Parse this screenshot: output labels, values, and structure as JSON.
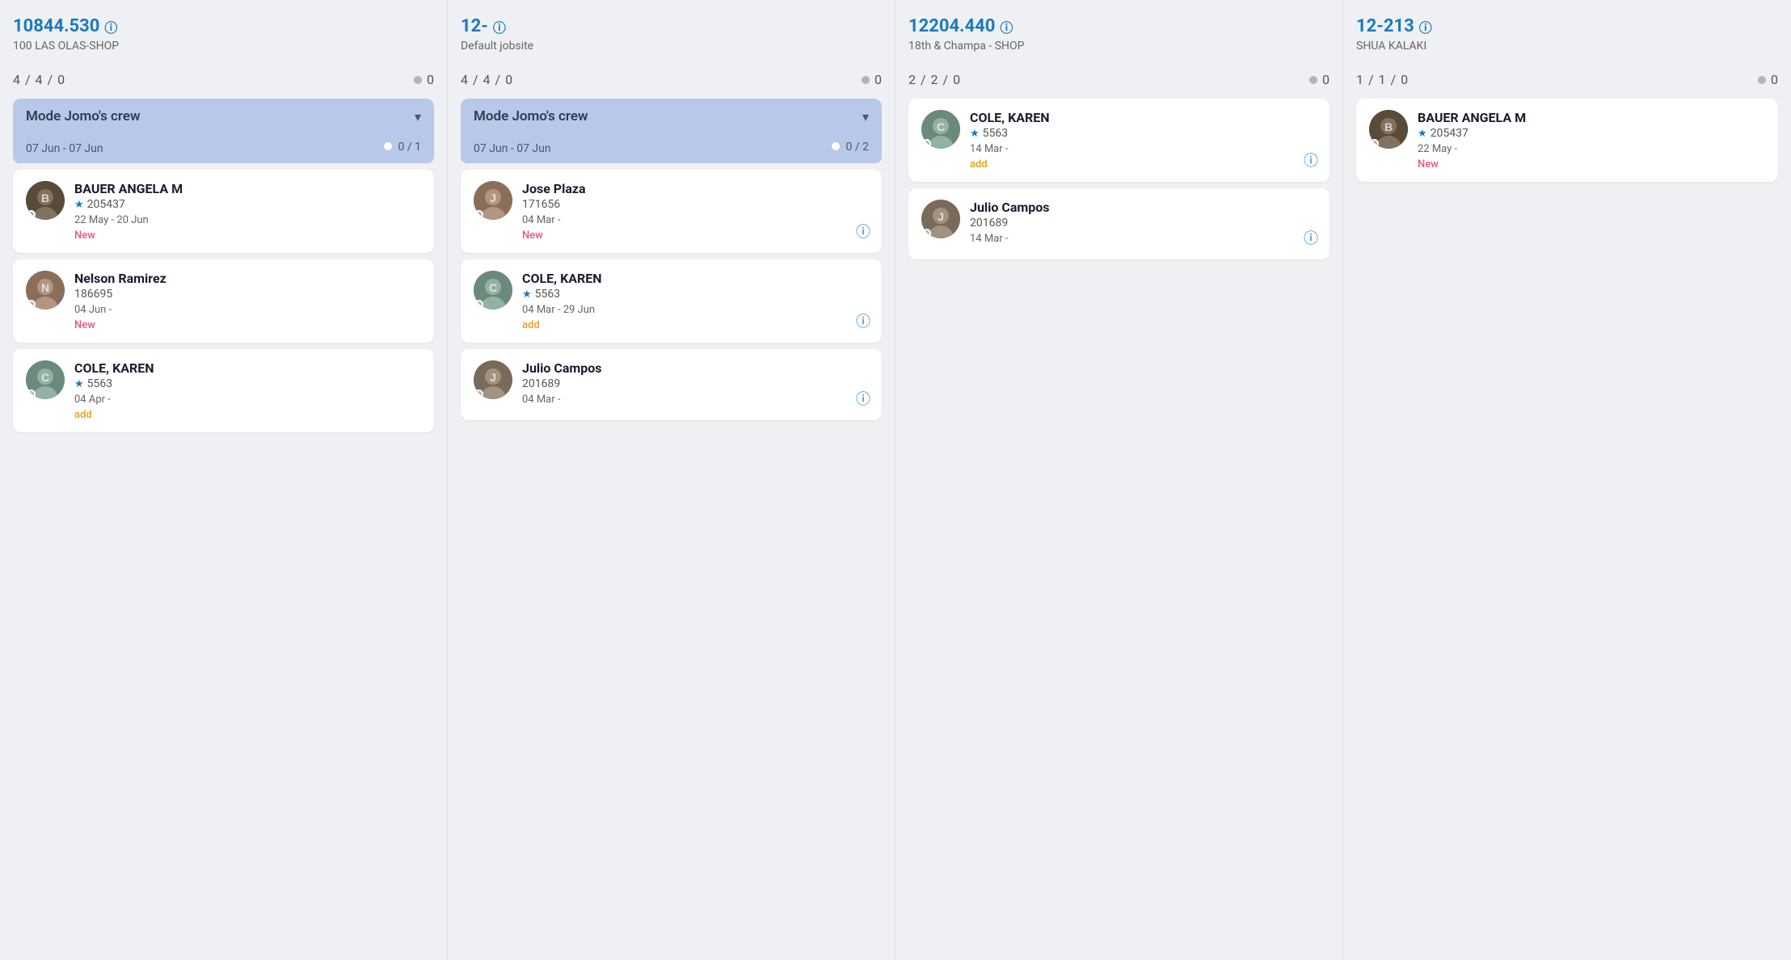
{
  "columns": [
    {
      "id": "col1",
      "title": "10844.530",
      "subtitle": "100 LAS OLAS-SHOP",
      "stats_left": "4 / 4 / 0",
      "stats_right": "0",
      "crew_group": {
        "name": "Mode Jomo's crew",
        "dates": "07 Jun - 07 Jun",
        "count": "0 / 1",
        "has_dot": true
      },
      "workers": [
        {
          "name": "BAUER ANGELA M",
          "id": "205437",
          "has_star": true,
          "dates": "22 May - 20 Jun",
          "status": "New",
          "status_type": "new",
          "has_info": false,
          "avatar_color": "av-dark",
          "avatar_letter": "B",
          "in_crew": true
        },
        {
          "name": "Nelson Ramirez",
          "id": "186695",
          "has_star": false,
          "dates": "04 Jun -",
          "status": "New",
          "status_type": "new",
          "has_info": false,
          "avatar_color": "av-brown",
          "avatar_letter": "N"
        },
        {
          "name": "COLE, KAREN",
          "id": "5563",
          "has_star": true,
          "dates": "04 Apr -",
          "status": "add",
          "status_type": "add",
          "has_info": false,
          "avatar_color": "av-medium",
          "avatar_letter": "C"
        }
      ]
    },
    {
      "id": "col2",
      "title": "12-",
      "subtitle": "Default jobsite",
      "stats_left": "4 / 4 / 0",
      "stats_right": "0",
      "crew_group": {
        "name": "Mode Jomo's crew",
        "dates": "07 Jun - 07 Jun",
        "count": "0 / 2",
        "has_dot": true
      },
      "workers": [
        {
          "name": "Jose Plaza",
          "id": "171656",
          "has_star": false,
          "dates": "04 Mar -",
          "status": "New",
          "status_type": "new",
          "has_info": true,
          "avatar_color": "av-brown",
          "avatar_letter": "J",
          "in_crew": true
        },
        {
          "name": "COLE, KAREN",
          "id": "5563",
          "has_star": true,
          "dates": "04 Mar - 29 Jun",
          "status": "add",
          "status_type": "add",
          "has_info": true,
          "avatar_color": "av-medium",
          "avatar_letter": "C"
        },
        {
          "name": "Julio Campos",
          "id": "201689",
          "has_star": false,
          "dates": "04 Mar -",
          "status": "",
          "status_type": "none",
          "has_info": true,
          "avatar_color": "av-light",
          "avatar_letter": "J"
        }
      ]
    },
    {
      "id": "col3",
      "title": "12204.440",
      "subtitle": "18th & Champa - SHOP",
      "stats_left": "2 / 2 / 0",
      "stats_right": "0",
      "crew_group": null,
      "workers": [
        {
          "name": "COLE, KAREN",
          "id": "5563",
          "has_star": true,
          "dates": "14 Mar -",
          "status": "add",
          "status_type": "add",
          "has_info": true,
          "avatar_color": "av-medium",
          "avatar_letter": "C"
        },
        {
          "name": "Julio Campos",
          "id": "201689",
          "has_star": false,
          "dates": "14 Mar -",
          "status": "",
          "status_type": "none",
          "has_info": true,
          "avatar_color": "av-light",
          "avatar_letter": "J"
        }
      ]
    },
    {
      "id": "col4",
      "title": "12-213",
      "subtitle": "SHUA KALAKI",
      "stats_left": "1 / 1 / 0",
      "stats_right": "0",
      "crew_group": null,
      "workers": [
        {
          "name": "BAUER ANGELA M",
          "id": "205437",
          "has_star": true,
          "dates": "22 May -",
          "status": "New",
          "status_type": "new",
          "has_info": false,
          "avatar_color": "av-dark",
          "avatar_letter": "B"
        }
      ]
    }
  ],
  "labels": {
    "info_circle": "ⓘ",
    "star": "★",
    "chevron_down": "▾",
    "chevron_up": "▴",
    "new": "New",
    "add": "add"
  }
}
